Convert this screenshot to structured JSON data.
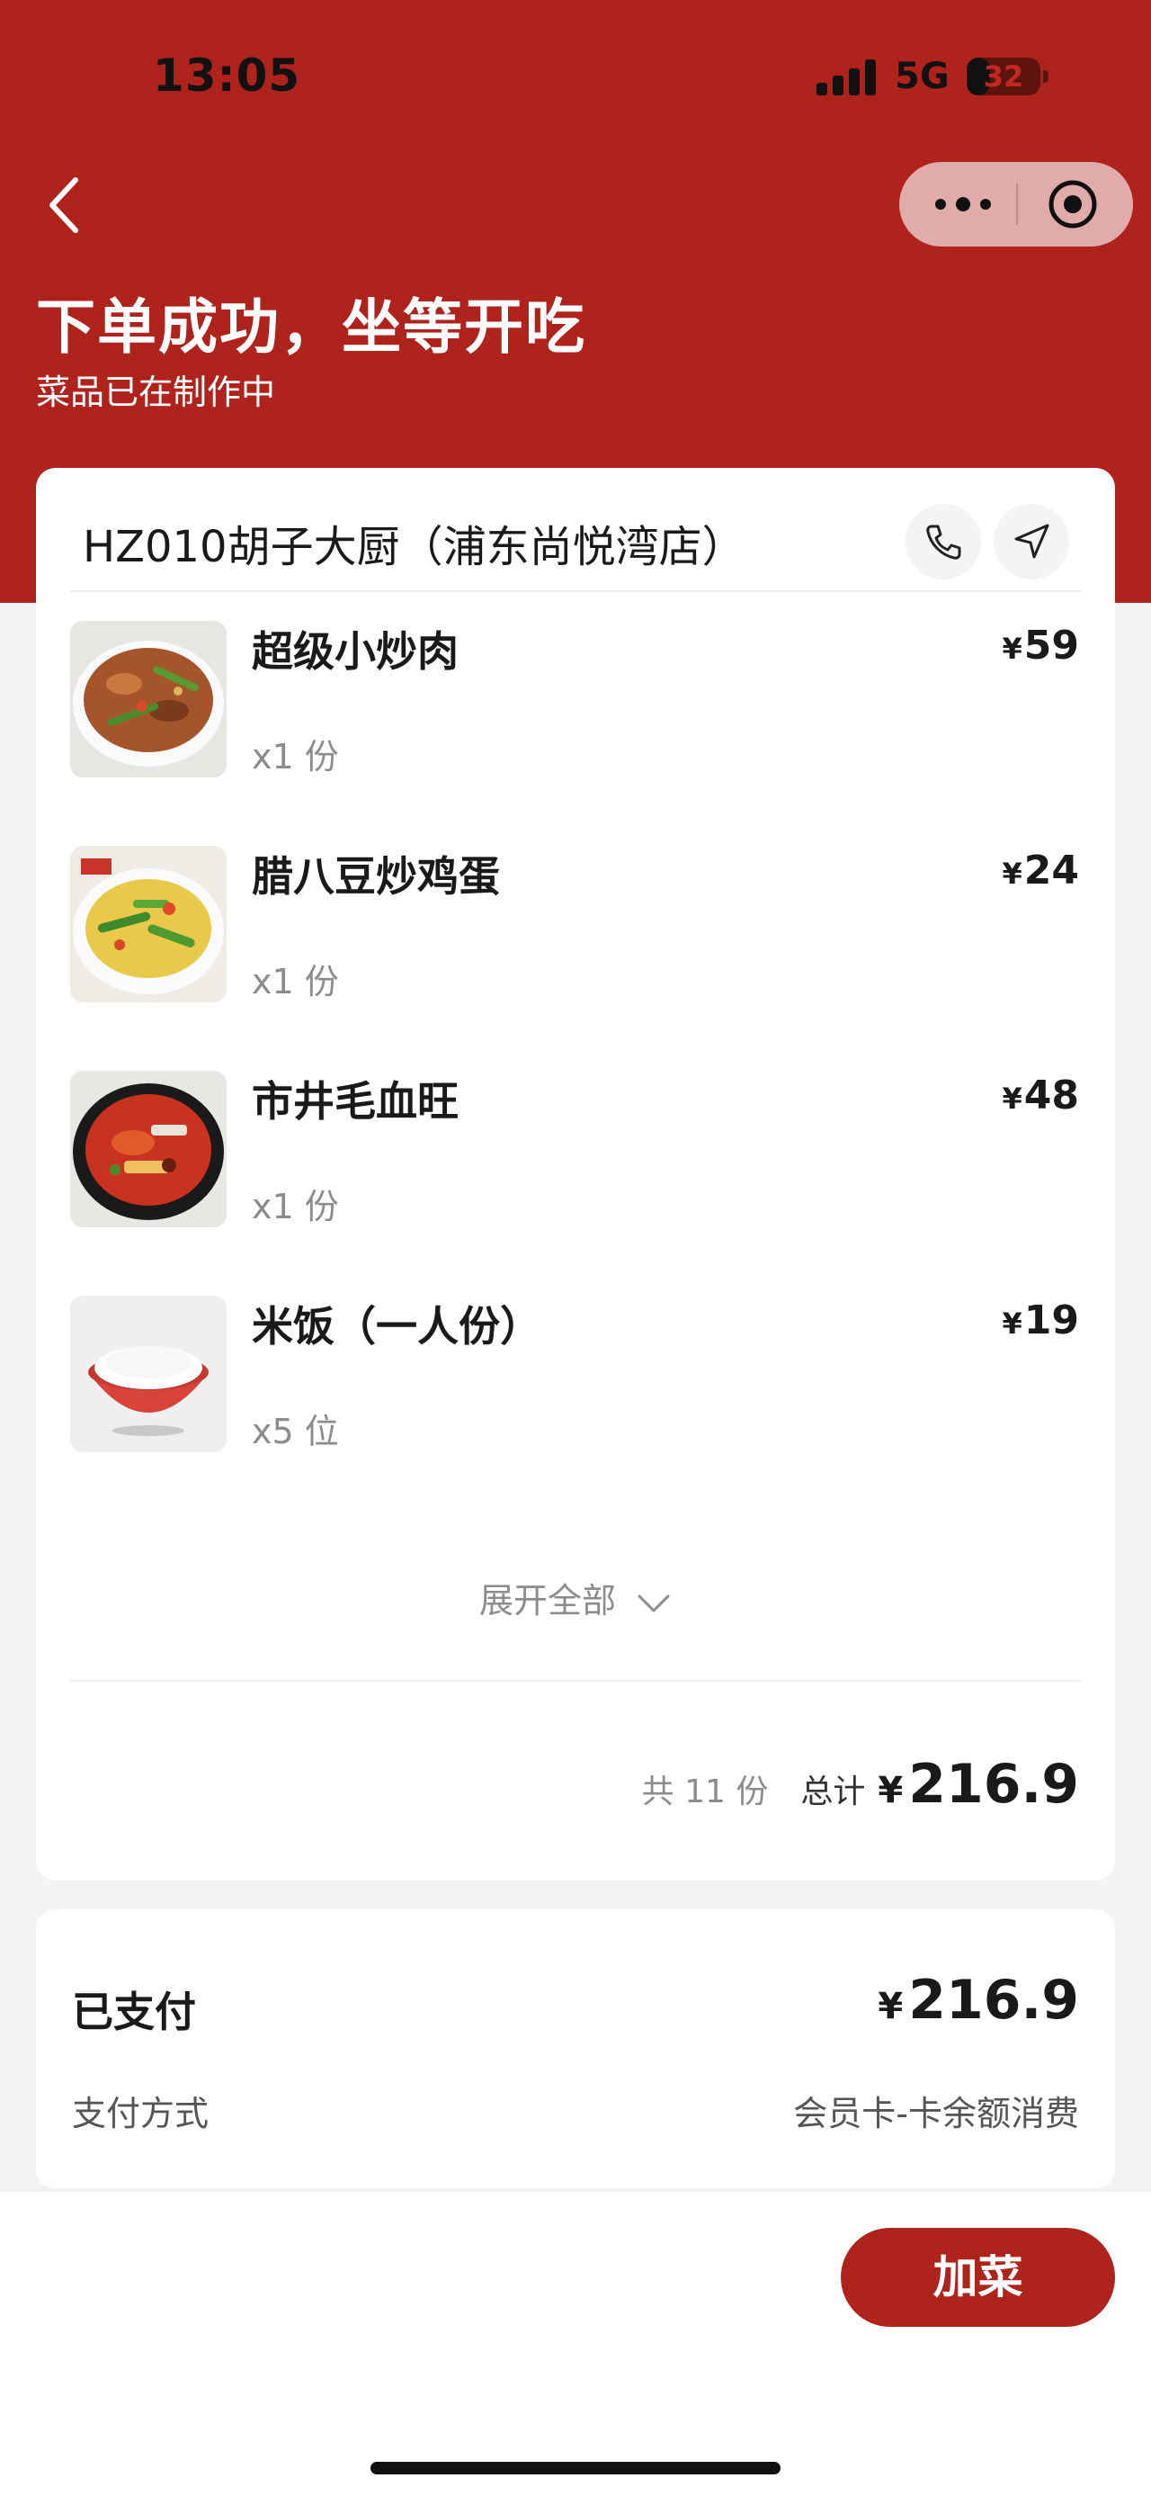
{
  "status_bar": {
    "time": "13:05",
    "network": "5G",
    "battery": "32",
    "battery_level": 0.32
  },
  "header": {
    "title": "下单成功，坐等开吃",
    "subtitle": "菜品已在制作中"
  },
  "store": {
    "name": "HZ010胡子大厨（浦东尚悦湾店）"
  },
  "items": [
    {
      "name": "超级小炒肉",
      "qty": "x1 份",
      "price": "59",
      "image": "stir-fried-pork-photo"
    },
    {
      "name": "腊八豆炒鸡蛋",
      "qty": "x1 份",
      "price": "24",
      "image": "fermented-bean-egg-photo"
    },
    {
      "name": "市井毛血旺",
      "qty": "x1 份",
      "price": "48",
      "image": "mao-xue-wang-photo"
    },
    {
      "name": "米饭（一人份）",
      "qty": "x5 位",
      "price": "19",
      "image": "rice-bowl-photo"
    }
  ],
  "currency": "¥",
  "expand_label": "展开全部",
  "summary": {
    "count": "共 11 份",
    "total_label": "总计",
    "total": "216.9"
  },
  "payment": {
    "paid_label": "已支付",
    "paid_amount": "216.9",
    "method_label": "支付方式",
    "method_value": "会员卡-卡余额消费"
  },
  "add_button": "加菜",
  "colors": {
    "brand_red": "#ae241c",
    "background": "#f4f4f4"
  }
}
